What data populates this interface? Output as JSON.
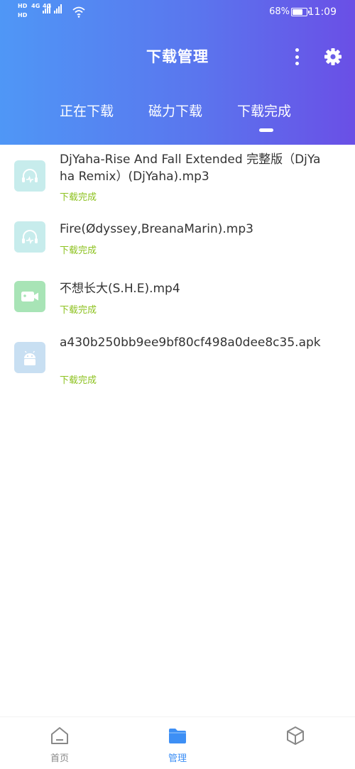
{
  "status_bar": {
    "sim1": {
      "hd": "HD",
      "net": "4G"
    },
    "sim2": {
      "hd": "HD",
      "net": "4G"
    },
    "battery_percent": "68%",
    "battery_level": 0.68,
    "time": "11:09"
  },
  "header": {
    "title": "下载管理",
    "more_icon": "more-vertical-icon",
    "settings_icon": "gear-icon",
    "gradient": [
      "#4f97f6",
      "#6a4fe6"
    ]
  },
  "tabs": [
    {
      "label": "正在下载",
      "active": false
    },
    {
      "label": "磁力下载",
      "active": false
    },
    {
      "label": "下载完成",
      "active": true
    }
  ],
  "downloads": [
    {
      "name": "DjYaha-Rise And Fall Extended 完整版（DjYaha Remix）(DjYaha).mp3",
      "status": "下载完成",
      "icon": "headphones-icon",
      "color": "#c7ecec"
    },
    {
      "name": "Fire(Ødyssey,BreanaMarin).mp3",
      "status": "下载完成",
      "icon": "headphones-icon",
      "color": "#c7ecec"
    },
    {
      "name": "不想长大(S.H.E).mp4",
      "status": "下载完成",
      "icon": "video-camera-icon",
      "color": "#a8e4b6"
    },
    {
      "name": "a430b250bb9ee9bf80cf498a0dee8c35.apk",
      "status": "下载完成",
      "icon": "android-icon",
      "color": "#c8dff2"
    }
  ],
  "bottom_nav": [
    {
      "label": "首页",
      "icon": "home-icon",
      "active": false
    },
    {
      "label": "管理",
      "icon": "folder-icon",
      "active": true
    },
    {
      "label": "",
      "icon": "cube-icon",
      "active": false
    }
  ],
  "colors": {
    "accent": "#3d8ff5",
    "status_done": "#8dc21f"
  }
}
